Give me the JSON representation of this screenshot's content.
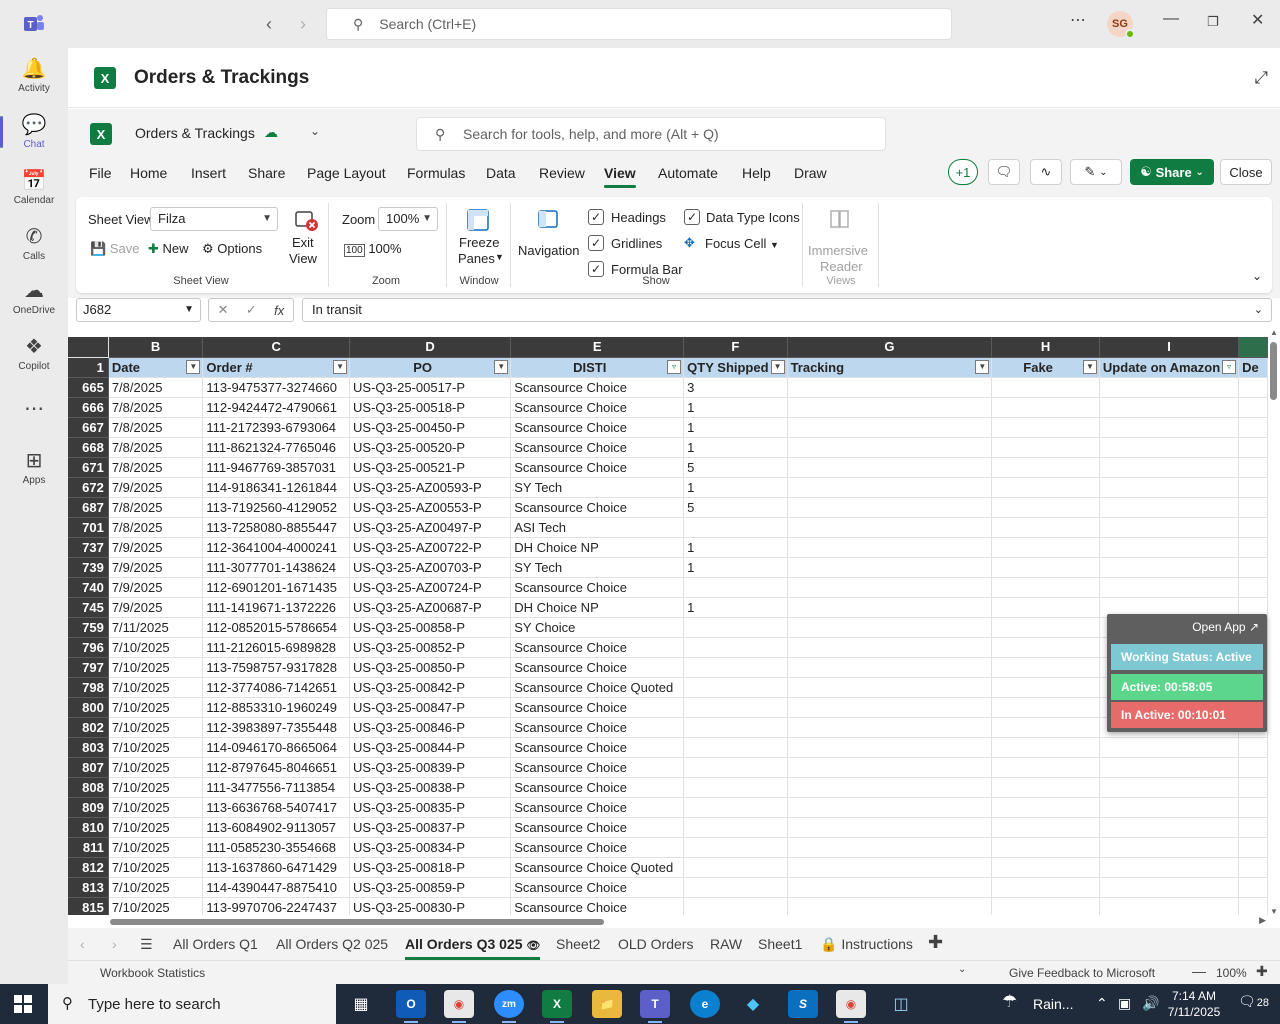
{
  "teams": {
    "search_placeholder": "Search (Ctrl+E)",
    "avatar_initials": "SG",
    "rail": [
      {
        "label": "Activity",
        "icon": "bell-icon"
      },
      {
        "label": "Chat",
        "icon": "chat-icon"
      },
      {
        "label": "Calendar",
        "icon": "calendar-icon"
      },
      {
        "label": "Calls",
        "icon": "phone-icon"
      },
      {
        "label": "OneDrive",
        "icon": "cloud-icon"
      },
      {
        "label": "Copilot",
        "icon": "copilot-icon"
      },
      {
        "label": "Apps",
        "icon": "apps-icon"
      }
    ]
  },
  "app": {
    "title": "Orders & Trackings"
  },
  "excel": {
    "workbook_name": "Orders & Trackings",
    "search_placeholder": "Search for tools, help, and more (Alt + Q)",
    "menu": [
      "File",
      "Home",
      "Insert",
      "Share",
      "Page Layout",
      "Formulas",
      "Data",
      "Review",
      "View",
      "Automate",
      "Help",
      "Draw"
    ],
    "active_menu": "View",
    "collab_count": "+1",
    "share_label": "Share",
    "close_label": "Close",
    "ribbon": {
      "sheet_view_label": "Sheet View",
      "sheet_view_value": "Filza",
      "save": "Save",
      "new": "New",
      "options": "Options",
      "exit_view": "Exit View",
      "exit_view_line1": "Exit",
      "exit_view_line2": "View",
      "group_sheet_view": "Sheet View",
      "zoom_label": "Zoom",
      "zoom_value": "100%",
      "zoom_100": "100%",
      "group_zoom": "Zoom",
      "freeze_line1": "Freeze",
      "freeze_line2": "Panes",
      "group_window": "Window",
      "navigation": "Navigation",
      "headings": "Headings",
      "gridlines": "Gridlines",
      "formula_bar": "Formula Bar",
      "data_type_icons": "Data Type Icons",
      "focus_cell": "Focus Cell",
      "group_show": "Show",
      "immersive_line1": "Immersive",
      "immersive_line2": "Reader",
      "group_views": "Views"
    },
    "name_box": "J682",
    "formula_value": "In transit",
    "columns": [
      "B",
      "C",
      "D",
      "E",
      "F",
      "G",
      "H",
      "I"
    ],
    "headers": [
      "Date",
      "Order #",
      "PO",
      "DISTI",
      "QTY Shipped",
      "Tracking",
      "Fake",
      "Update on Amazon",
      "De"
    ],
    "rows": [
      {
        "n": "665",
        "date": "7/8/2025",
        "order": "113-9475377-3274660",
        "po": "US-Q3-25-00517-P",
        "disti": "Scansource Choice",
        "qty": "3"
      },
      {
        "n": "666",
        "date": "7/8/2025",
        "order": "112-9424472-4790661",
        "po": "US-Q3-25-00518-P",
        "disti": "Scansource Choice",
        "qty": "1"
      },
      {
        "n": "667",
        "date": "7/8/2025",
        "order": "111-2172393-6793064",
        "po": "US-Q3-25-00450-P",
        "disti": "Scansource Choice",
        "qty": "1"
      },
      {
        "n": "668",
        "date": "7/8/2025",
        "order": "111-8621324-7765046",
        "po": "US-Q3-25-00520-P",
        "disti": "Scansource Choice",
        "qty": "1"
      },
      {
        "n": "671",
        "date": "7/8/2025",
        "order": "111-9467769-3857031",
        "po": "US-Q3-25-00521-P",
        "disti": "Scansource Choice",
        "qty": "5"
      },
      {
        "n": "672",
        "date": "7/9/2025",
        "order": "114-9186341-1261844",
        "po": "US-Q3-25-AZ00593-P",
        "disti": "SY Tech",
        "qty": "1"
      },
      {
        "n": "687",
        "date": "7/8/2025",
        "order": "113-7192560-4129052",
        "po": "US-Q3-25-AZ00553-P",
        "disti": "Scansource Choice",
        "qty": "5"
      },
      {
        "n": "701",
        "date": "7/8/2025",
        "order": "113-7258080-8855447",
        "po": "US-Q3-25-AZ00497-P",
        "disti": "ASI Tech",
        "qty": ""
      },
      {
        "n": "737",
        "date": "7/9/2025",
        "order": "112-3641004-4000241",
        "po": "US-Q3-25-AZ00722-P",
        "disti": "DH Choice NP",
        "qty": "1"
      },
      {
        "n": "739",
        "date": "7/9/2025",
        "order": "111-3077701-1438624",
        "po": "US-Q3-25-AZ00703-P",
        "disti": "SY Tech",
        "qty": "1"
      },
      {
        "n": "740",
        "date": "7/9/2025",
        "order": "112-6901201-1671435",
        "po": "US-Q3-25-AZ00724-P",
        "disti": "Scansource Choice",
        "qty": ""
      },
      {
        "n": "745",
        "date": "7/9/2025",
        "order": "111-1419671-1372226",
        "po": "US-Q3-25-AZ00687-P",
        "disti": "DH Choice NP",
        "qty": "1"
      },
      {
        "n": "759",
        "date": "7/11/2025",
        "order": "112-0852015-5786654",
        "po": "US-Q3-25-00858-P",
        "disti": "SY Choice",
        "qty": ""
      },
      {
        "n": "796",
        "date": "7/10/2025",
        "order": "111-2126015-6989828",
        "po": "US-Q3-25-00852-P",
        "disti": "Scansource Choice",
        "qty": ""
      },
      {
        "n": "797",
        "date": "7/10/2025",
        "order": "113-7598757-9317828",
        "po": "US-Q3-25-00850-P",
        "disti": "Scansource Choice",
        "qty": ""
      },
      {
        "n": "798",
        "date": "7/10/2025",
        "order": "112-3774086-7142651",
        "po": "US-Q3-25-00842-P",
        "disti": "Scansource Choice Quoted",
        "qty": ""
      },
      {
        "n": "800",
        "date": "7/10/2025",
        "order": "112-8853310-1960249",
        "po": "US-Q3-25-00847-P",
        "disti": "Scansource Choice",
        "qty": ""
      },
      {
        "n": "802",
        "date": "7/10/2025",
        "order": "112-3983897-7355448",
        "po": "US-Q3-25-00846-P",
        "disti": "Scansource Choice",
        "qty": ""
      },
      {
        "n": "803",
        "date": "7/10/2025",
        "order": "114-0946170-8665064",
        "po": "US-Q3-25-00844-P",
        "disti": "Scansource Choice",
        "qty": ""
      },
      {
        "n": "807",
        "date": "7/10/2025",
        "order": "112-8797645-8046651",
        "po": "US-Q3-25-00839-P",
        "disti": "Scansource Choice",
        "qty": ""
      },
      {
        "n": "808",
        "date": "7/10/2025",
        "order": "111-3477556-7113854",
        "po": "US-Q3-25-00838-P",
        "disti": "Scansource Choice",
        "qty": ""
      },
      {
        "n": "809",
        "date": "7/10/2025",
        "order": "113-6636768-5407417",
        "po": "US-Q3-25-00835-P",
        "disti": "Scansource Choice",
        "qty": ""
      },
      {
        "n": "810",
        "date": "7/10/2025",
        "order": "113-6084902-9113057",
        "po": "US-Q3-25-00837-P",
        "disti": "Scansource Choice",
        "qty": ""
      },
      {
        "n": "811",
        "date": "7/10/2025",
        "order": "111-0585230-3554668",
        "po": "US-Q3-25-00834-P",
        "disti": "Scansource Choice",
        "qty": ""
      },
      {
        "n": "812",
        "date": "7/10/2025",
        "order": "113-1637860-6471429",
        "po": "US-Q3-25-00818-P",
        "disti": "Scansource Choice Quoted",
        "qty": ""
      },
      {
        "n": "813",
        "date": "7/10/2025",
        "order": "114-4390447-8875410",
        "po": "US-Q3-25-00859-P",
        "disti": "Scansource Choice",
        "qty": ""
      },
      {
        "n": "815",
        "date": "7/10/2025",
        "order": "113-9970706-2247437",
        "po": "US-Q3-25-00830-P",
        "disti": "Scansource Choice",
        "qty": ""
      }
    ],
    "sheet_tabs": [
      "All Orders Q1",
      "All Orders Q2 025",
      "All Orders Q3 025",
      "Sheet2",
      "OLD Orders",
      "RAW",
      "Sheet1",
      "Instructions"
    ],
    "active_tab": "All Orders Q3 025",
    "status_left": "Workbook Statistics",
    "feedback": "Give Feedback to Microsoft",
    "zoom_status": "100%"
  },
  "tracker": {
    "open_app": "Open App",
    "status": "Working Status: Active",
    "active": "Active: 00:58:05",
    "inactive": "In Active: 00:10:01",
    "colors": {
      "status": "#7ec8d3",
      "active": "#5cd68c",
      "inactive": "#e86b6b"
    }
  },
  "taskbar": {
    "search_placeholder": "Type here to search",
    "weather": "Rain...",
    "time": "7:14 AM",
    "date": "7/11/2025",
    "notifications": "28"
  }
}
